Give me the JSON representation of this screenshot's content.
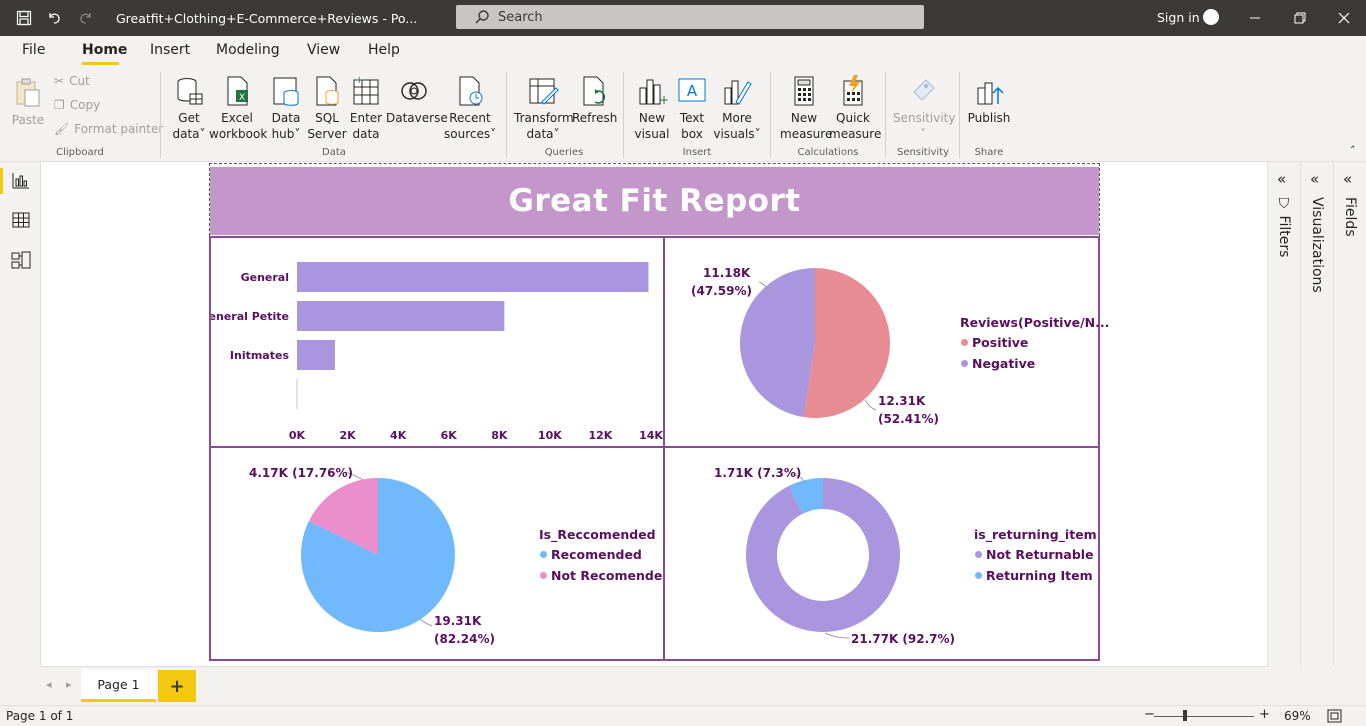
{
  "titlebar": {
    "document_title": "Greatfit+Clothing+E-Commerce+Reviews - Po...",
    "search_label": "Search",
    "signin_label": "Sign in"
  },
  "menu": {
    "file": "File",
    "home": "Home",
    "insert": "Insert",
    "modeling": "Modeling",
    "view": "View",
    "help": "Help"
  },
  "ribbon": {
    "clipboard": {
      "paste": "Paste",
      "cut": "Cut",
      "copy": "Copy",
      "format_painter": "Format painter",
      "group": "Clipboard"
    },
    "data": {
      "get_data_1": "Get",
      "get_data_2": "data",
      "excel_1": "Excel",
      "excel_2": "workbook",
      "hub_1": "Data",
      "hub_2": "hub",
      "sql_1": "SQL",
      "sql_2": "Server",
      "enter_1": "Enter",
      "enter_2": "data",
      "dataverse": "Dataverse",
      "recent_1": "Recent",
      "recent_2": "sources",
      "group": "Data"
    },
    "queries": {
      "transform_1": "Transform",
      "transform_2": "data",
      "refresh": "Refresh",
      "group": "Queries"
    },
    "insert": {
      "new_visual_1": "New",
      "new_visual_2": "visual",
      "text_box_1": "Text",
      "text_box_2": "box",
      "more_visuals_1": "More",
      "more_visuals_2": "visuals",
      "group": "Insert"
    },
    "calculations": {
      "new_measure_1": "New",
      "new_measure_2": "measure",
      "quick_measure_1": "Quick",
      "quick_measure_2": "measure",
      "group": "Calculations"
    },
    "sensitivity": {
      "label": "Sensitivity",
      "group": "Sensitivity"
    },
    "share": {
      "publish": "Publish",
      "group": "Share"
    }
  },
  "report": {
    "title": "Great Fit Report",
    "bar_chart": {
      "categories": [
        "General",
        "General Petite",
        "Initmates",
        ""
      ],
      "values": [
        13900,
        8200,
        1500,
        0
      ],
      "x_ticks": [
        "0K",
        "2K",
        "4K",
        "6K",
        "8K",
        "10K",
        "12K",
        "14K"
      ],
      "xlim": [
        0,
        14000
      ],
      "color": "#a996de"
    },
    "pie_reviews": {
      "legend_title": "Reviews(Positive/N...",
      "slices": [
        {
          "name": "Positive",
          "value": 12.31,
          "label_1": "12.31K",
          "label_2": "(52.41%)",
          "color": "#e88c94"
        },
        {
          "name": "Negative",
          "value": 11.18,
          "label_1": "11.18K",
          "label_2": "(47.59%)",
          "color": "#a996de"
        }
      ]
    },
    "pie_recommended": {
      "legend_title": "Is_Reccomended",
      "slices": [
        {
          "name": "Recomended",
          "value": 19.31,
          "label_1": "19.31K",
          "label_2": "(82.24%)",
          "color": "#6fb9fc"
        },
        {
          "name": "Not Recomended",
          "value": 4.17,
          "label_1": "4.17K (17.76%)",
          "label_2": "",
          "color": "#ea8fcb"
        }
      ]
    },
    "donut_returning": {
      "legend_title": "is_returning_item",
      "slices": [
        {
          "name": "Not Returnable",
          "value": 21.77,
          "label_1": "21.77K (92.7%)",
          "color": "#a996de"
        },
        {
          "name": "Returning Item",
          "value": 1.71,
          "label_1": "1.71K (7.3%)",
          "color": "#6fb9fc"
        }
      ]
    }
  },
  "chart_data": [
    {
      "type": "bar",
      "orientation": "horizontal",
      "categories": [
        "General",
        "General Petite",
        "Initmates",
        ""
      ],
      "values": [
        13900,
        8200,
        1500,
        0
      ],
      "xlim": [
        0,
        14000
      ],
      "x_tick_labels": [
        "0K",
        "2K",
        "4K",
        "6K",
        "8K",
        "10K",
        "12K",
        "14K"
      ]
    },
    {
      "type": "pie",
      "legend_title": "Reviews(Positive/N...",
      "labels": [
        "Positive",
        "Negative"
      ],
      "values": [
        12310,
        11180
      ],
      "percentages": [
        52.41,
        47.59
      ]
    },
    {
      "type": "pie",
      "legend_title": "Is_Reccomended",
      "labels": [
        "Recomended",
        "Not Recomended"
      ],
      "values": [
        19310,
        4170
      ],
      "percentages": [
        82.24,
        17.76
      ]
    },
    {
      "type": "pie",
      "style": "donut",
      "legend_title": "is_returning_item",
      "labels": [
        "Not Returnable",
        "Returning Item"
      ],
      "values": [
        21770,
        1710
      ],
      "percentages": [
        92.7,
        7.3
      ]
    }
  ],
  "panes": {
    "filters": "Filters",
    "visualizations": "Visualizations",
    "fields": "Fields"
  },
  "pages": {
    "tab": "Page 1",
    "add": "+"
  },
  "status": {
    "page_info": "Page 1 of 1",
    "zoom": "69%",
    "zoom_value": 0.69
  },
  "colors": {
    "accent": "#f2c811",
    "banner": "#c497cb",
    "border": "#8a4a96",
    "text": "#5a1060"
  }
}
